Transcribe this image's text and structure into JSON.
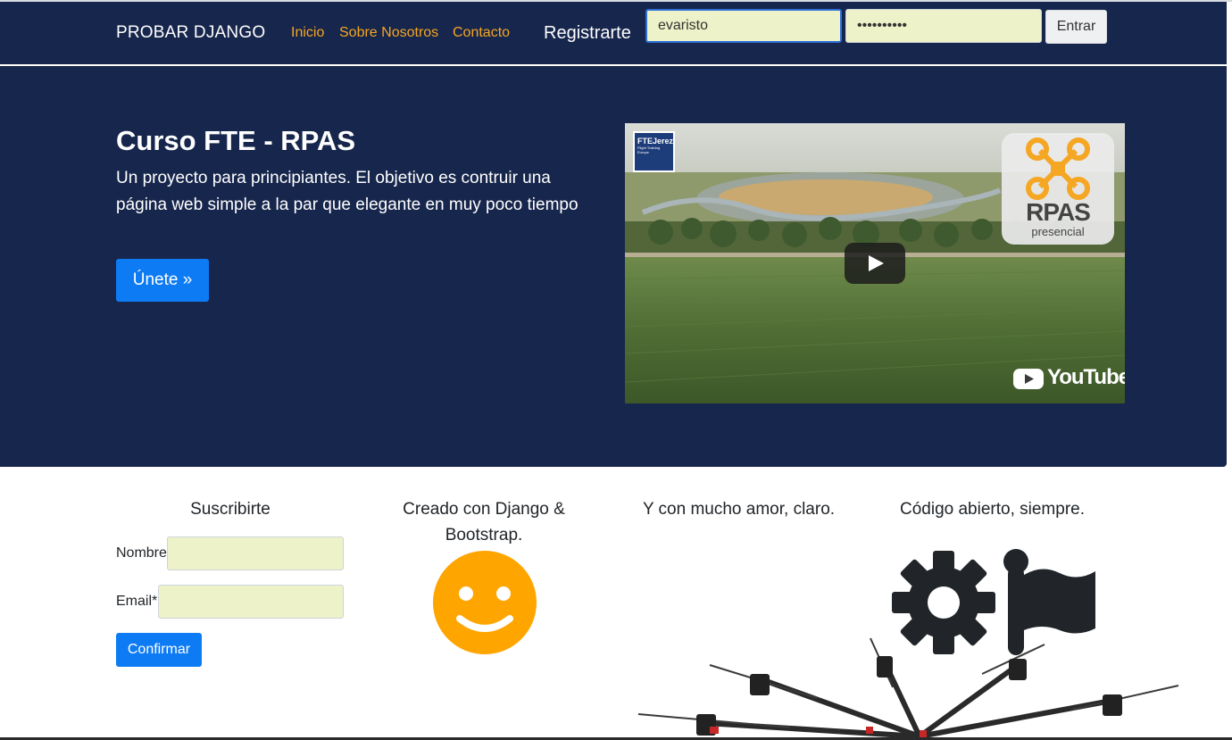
{
  "navbar": {
    "brand": "PROBAR DJANGO",
    "links": [
      "Inicio",
      "Sobre Nosotros",
      "Contacto"
    ],
    "register": "Registrarte",
    "username_value": "evaristo",
    "password_value": "••••••••••",
    "enter_label": "Entrar"
  },
  "hero": {
    "title": "Curso FTE - RPAS",
    "text": "Un proyecto para principiantes. El objetivo es contruir una página web simple a la par que elegante en muy poco tiempo",
    "join_label": "Únete »",
    "video": {
      "channel_logo": "FTEJerez",
      "channel_logo_sub": "Flight Training Europe",
      "badge_title": "RPAS",
      "badge_subtitle": "presencial",
      "youtube_label": "YouTube"
    }
  },
  "sections": {
    "subscribe": {
      "title": "Suscribirte",
      "name_label": "Nombre",
      "email_label": "Email*",
      "confirm_label": "Confirmar"
    },
    "col2_title": "Creado con Django & Bootstrap.",
    "col3_title": "Y con mucho amor, claro.",
    "col4_title": "Código abierto, siempre."
  },
  "colors": {
    "navy": "#17264c",
    "link": "#f5a623",
    "primary": "#0d7bf4",
    "input_bg": "#eef2c8",
    "smiley": "#ffa500",
    "icon_dark": "#212529"
  },
  "icons": [
    "smiley-icon",
    "gear-icon",
    "flag-icon",
    "play-icon",
    "youtube-icon",
    "drone-icon"
  ]
}
